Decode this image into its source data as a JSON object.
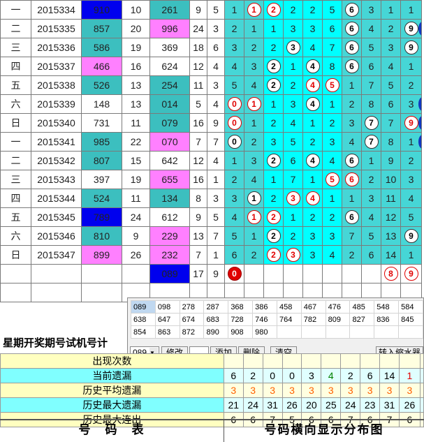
{
  "rows": [
    {
      "weekday": "一",
      "period": "2015334",
      "draw": "910",
      "sum": "10",
      "trial": "261",
      "span": "9",
      "x": "5",
      "drawColor": "blue",
      "trialColor": "sea",
      "cells": [
        "1",
        "1r",
        "2r",
        "2",
        "2",
        "5",
        "6b",
        "3",
        "1",
        "1"
      ]
    },
    {
      "weekday": "二",
      "period": "2015335",
      "draw": "857",
      "sum": "20",
      "trial": "996",
      "span": "24",
      "x": "3",
      "drawColor": "sea",
      "trialColor": "pink",
      "cells": [
        "2",
        "1",
        "1",
        "3",
        "3",
        "6",
        "6b",
        "4",
        "2",
        "9b"
      ]
    },
    {
      "weekday": "三",
      "period": "2015336",
      "draw": "586",
      "sum": "19",
      "trial": "369",
      "span": "18",
      "x": "6",
      "drawColor": "sea",
      "trialColor": "white",
      "cells": [
        "3",
        "2",
        "2",
        "3b",
        "4",
        "7",
        "6b",
        "5",
        "3",
        "9b"
      ]
    },
    {
      "weekday": "四",
      "period": "2015337",
      "draw": "466",
      "sum": "16",
      "trial": "624",
      "span": "12",
      "x": "4",
      "drawColor": "pink",
      "trialColor": "white",
      "cells": [
        "4",
        "3",
        "2b",
        "1",
        "4b",
        "8",
        "6b",
        "6",
        "4",
        "1"
      ]
    },
    {
      "weekday": "五",
      "period": "2015338",
      "draw": "526",
      "sum": "13",
      "trial": "254",
      "span": "11",
      "x": "3",
      "drawColor": "sea",
      "trialColor": "sea",
      "cells": [
        "5",
        "4",
        "2b",
        "2",
        "4r",
        "5r",
        "1",
        "7",
        "5",
        "2"
      ]
    },
    {
      "weekday": "六",
      "period": "2015339",
      "draw": "148",
      "sum": "13",
      "trial": "014",
      "span": "5",
      "x": "4",
      "drawColor": "white",
      "trialColor": "sea",
      "cells": [
        "0r",
        "1r",
        "1",
        "3",
        "4b",
        "1",
        "2",
        "8",
        "6",
        "3"
      ]
    },
    {
      "weekday": "日",
      "period": "2015340",
      "draw": "731",
      "sum": "11",
      "trial": "079",
      "span": "16",
      "x": "9",
      "drawColor": "white",
      "trialColor": "sea",
      "cells": [
        "0r",
        "1",
        "2",
        "4",
        "1",
        "2",
        "3",
        "7b",
        "7",
        "9r"
      ]
    },
    {
      "weekday": "一",
      "period": "2015341",
      "draw": "985",
      "sum": "22",
      "trial": "070",
      "span": "7",
      "x": "7",
      "drawColor": "sea",
      "trialColor": "pink",
      "cells": [
        "0b",
        "2",
        "3",
        "5",
        "2",
        "3",
        "4",
        "7b",
        "8",
        "1"
      ]
    },
    {
      "weekday": "二",
      "period": "2015342",
      "draw": "807",
      "sum": "15",
      "trial": "642",
      "span": "12",
      "x": "4",
      "drawColor": "sea",
      "trialColor": "white",
      "cells": [
        "1",
        "3",
        "2b",
        "6",
        "4b",
        "4",
        "6b",
        "1",
        "9",
        "2"
      ]
    },
    {
      "weekday": "三",
      "period": "2015343",
      "draw": "397",
      "sum": "19",
      "trial": "655",
      "span": "16",
      "x": "1",
      "drawColor": "white",
      "trialColor": "pink",
      "cells": [
        "2",
        "4",
        "1",
        "7",
        "1",
        "5r",
        "6r",
        "2",
        "10",
        "3"
      ]
    },
    {
      "weekday": "四",
      "period": "2015344",
      "draw": "524",
      "sum": "11",
      "trial": "134",
      "span": "8",
      "x": "3",
      "drawColor": "sea",
      "trialColor": "sea",
      "cells": [
        "3",
        "1b",
        "2",
        "3r",
        "4r",
        "1",
        "1",
        "3",
        "11",
        "4"
      ]
    },
    {
      "weekday": "五",
      "period": "2015345",
      "draw": "789",
      "sum": "24",
      "trial": "612",
      "span": "9",
      "x": "5",
      "drawColor": "blue",
      "trialColor": "white",
      "cells": [
        "4",
        "1r",
        "2r",
        "1",
        "2",
        "2",
        "6b",
        "4",
        "12",
        "5"
      ]
    },
    {
      "weekday": "六",
      "period": "2015346",
      "draw": "810",
      "sum": "9",
      "trial": "229",
      "span": "13",
      "x": "7",
      "drawColor": "sea",
      "trialColor": "pink",
      "cells": [
        "5",
        "1",
        "2b",
        "2",
        "3",
        "3",
        "7",
        "5",
        "13",
        "9b"
      ]
    },
    {
      "weekday": "日",
      "period": "2015347",
      "draw": "899",
      "sum": "26",
      "trial": "232",
      "span": "7",
      "x": "1",
      "drawColor": "pink",
      "trialColor": "pink",
      "cells": [
        "6",
        "2",
        "2r",
        "3r",
        "3",
        "4",
        "2",
        "6",
        "14",
        "1"
      ]
    }
  ],
  "current": {
    "trial": "089",
    "span": "17",
    "x": "9",
    "ball0": "0",
    "ball8": "8",
    "ball9": "9"
  },
  "popup": {
    "numbers": [
      "089",
      "098",
      "278",
      "287",
      "368",
      "386",
      "458",
      "467",
      "476",
      "485",
      "548",
      "584",
      "638",
      "647",
      "674",
      "683",
      "728",
      "746",
      "764",
      "782",
      "809",
      "827",
      "836",
      "845",
      "854",
      "863",
      "872",
      "890",
      "908",
      "980"
    ],
    "select_value": "089",
    "btn_modify": "修改",
    "btn_add": "添加",
    "btn_delete": "删除",
    "btn_clear": "清空",
    "btn_transfer": "转入缩水器"
  },
  "header_text": "星期开奖期号试机号计",
  "stats": [
    {
      "label": "出现次数",
      "values": [],
      "style": "y"
    },
    {
      "label": "当前遗漏",
      "values": [
        "6",
        "2",
        "0",
        "0",
        "3",
        "4",
        "2",
        "6",
        "14",
        "1"
      ],
      "style": "c"
    },
    {
      "label": "历史平均遗漏",
      "values": [
        "3",
        "3",
        "3",
        "3",
        "3",
        "3",
        "3",
        "3",
        "3",
        "3"
      ],
      "style": "y"
    },
    {
      "label": "历史最大遗漏",
      "values": [
        "21",
        "24",
        "31",
        "26",
        "20",
        "25",
        "24",
        "23",
        "31",
        "26"
      ],
      "style": "c"
    },
    {
      "label": "历史最大连出",
      "values": [
        "6",
        "6",
        "7",
        "5",
        "6",
        "6",
        "7",
        "6",
        "7",
        "6"
      ],
      "style": "y"
    }
  ],
  "footer_left": "号　码　表",
  "footer_right": "号码横向显示分布图"
}
